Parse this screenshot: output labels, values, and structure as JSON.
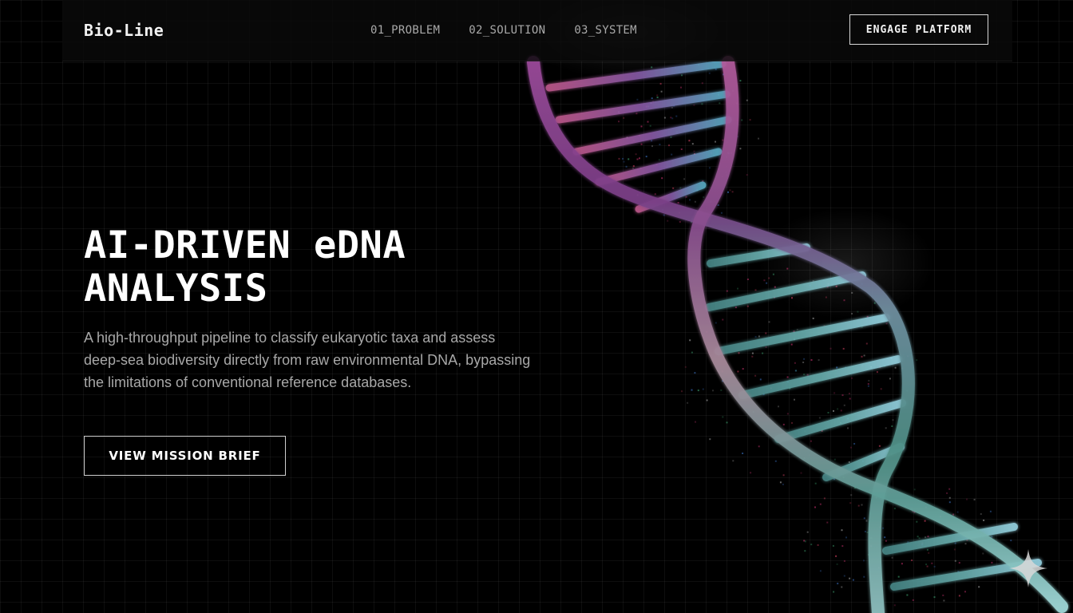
{
  "header": {
    "logo": "Bio-Line",
    "nav": [
      "01_PROBLEM",
      "02_SOLUTION",
      "03_SYSTEM"
    ],
    "cta_label": "ENGAGE PLATFORM"
  },
  "hero": {
    "title_line1": "AI-DRIVEN eDNA",
    "title_line2": "ANALYSIS",
    "description": "A high-throughput pipeline to classify eukaryotic taxa and assess deep-sea biodiversity directly from raw environmental DNA, bypassing the limitations of conventional reference databases.",
    "button_label": "VIEW MISSION BRIEF"
  },
  "decor": {
    "background_color": "#000000",
    "helix_colors": [
      "#8a3a8f",
      "#c45a8a",
      "#3aa0a8",
      "#7fd0e0"
    ],
    "helix_icon": "dna-helix-illustration",
    "corner_icon": "sparkle-icon"
  }
}
